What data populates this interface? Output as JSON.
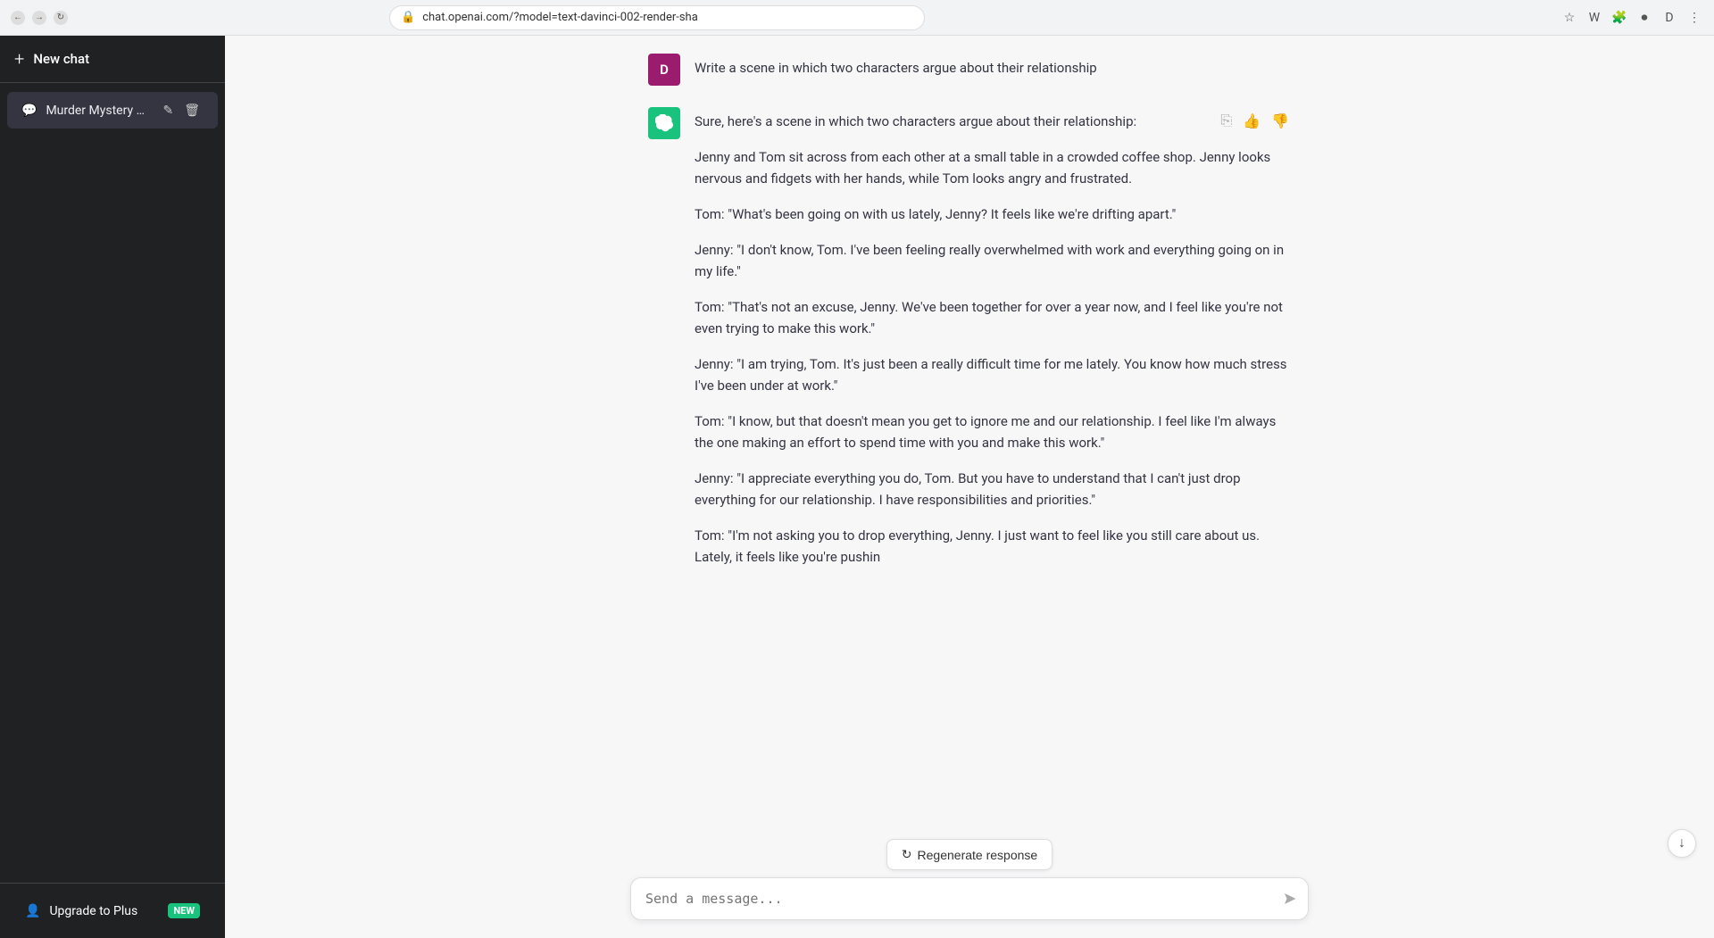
{
  "browser": {
    "url": "chat.openai.com/?model=text-davinci-002-render-sha",
    "back_label": "←",
    "forward_label": "→",
    "reload_label": "↻"
  },
  "sidebar": {
    "new_chat_label": "New chat",
    "chats": [
      {
        "id": 1,
        "title": "Murder Mystery Plot..",
        "active": true
      }
    ],
    "upgrade_label": "Upgrade to Plus",
    "upgrade_badge": "NEW"
  },
  "chat": {
    "messages": [
      {
        "role": "user",
        "avatar_initials": "D",
        "text": "Write a scene in which two characters argue about their relationship"
      },
      {
        "role": "assistant",
        "paragraphs": [
          "Sure, here's a scene in which two characters argue about their relationship:",
          "Jenny and Tom sit across from each other at a small table in a crowded coffee shop. Jenny looks nervous and fidgets with her hands, while Tom looks angry and frustrated.",
          "Tom: \"What's been going on with us lately, Jenny? It feels like we're drifting apart.\"",
          "Jenny: \"I don't know, Tom. I've been feeling really overwhelmed with work and everything going on in my life.\"",
          "Tom: \"That's not an excuse, Jenny. We've been together for over a year now, and I feel like you're not even trying to make this work.\"",
          "Jenny: \"I am trying, Tom. It's just been a really difficult time for me lately. You know how much stress I've been under at work.\"",
          "Tom: \"I know, but that doesn't mean you get to ignore me and our relationship. I feel like I'm always the one making an effort to spend time with you and make this work.\"",
          "Jenny: \"I appreciate everything you do, Tom. But you have to understand that I can't just drop everything for our relationship. I have responsibilities and priorities.\"",
          "Tom: \"I'm not asking you to drop everything, Jenny. I just want to feel like you still care about us. Lately, it feels like you're pushin"
        ]
      }
    ],
    "regen_label": "Regenerate response",
    "input_placeholder": "Send a message...",
    "scroll_down_label": "↓"
  },
  "icons": {
    "copy": "⧉",
    "thumbs_up": "👍",
    "thumbs_down": "👎",
    "edit": "✏",
    "delete": "🗑",
    "send": "➤",
    "regen": "↺",
    "user": "👤",
    "plus": "+"
  }
}
